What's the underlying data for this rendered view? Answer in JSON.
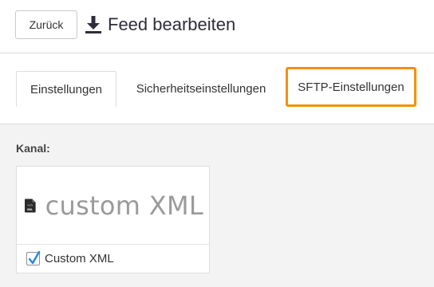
{
  "header": {
    "back_label": "Zurück",
    "title": "Feed bearbeiten",
    "icon": "download-icon"
  },
  "tabs": [
    {
      "label": "Einstellungen",
      "active": true
    },
    {
      "label": "Sicherheitseinstellungen",
      "active": false
    },
    {
      "label": "SFTP-Einstellungen",
      "active": false,
      "highlighted": true
    }
  ],
  "channel": {
    "label": "Kanal:",
    "card": {
      "logo_text": "custom XML",
      "logo_icon_text": "XML",
      "logo_icon_glyph": "</>",
      "checkbox_label": "Custom XML",
      "checked": true
    }
  },
  "colors": {
    "highlight": "#f39200",
    "checkmark": "#1e88e5",
    "background": "#f3f3f3"
  }
}
